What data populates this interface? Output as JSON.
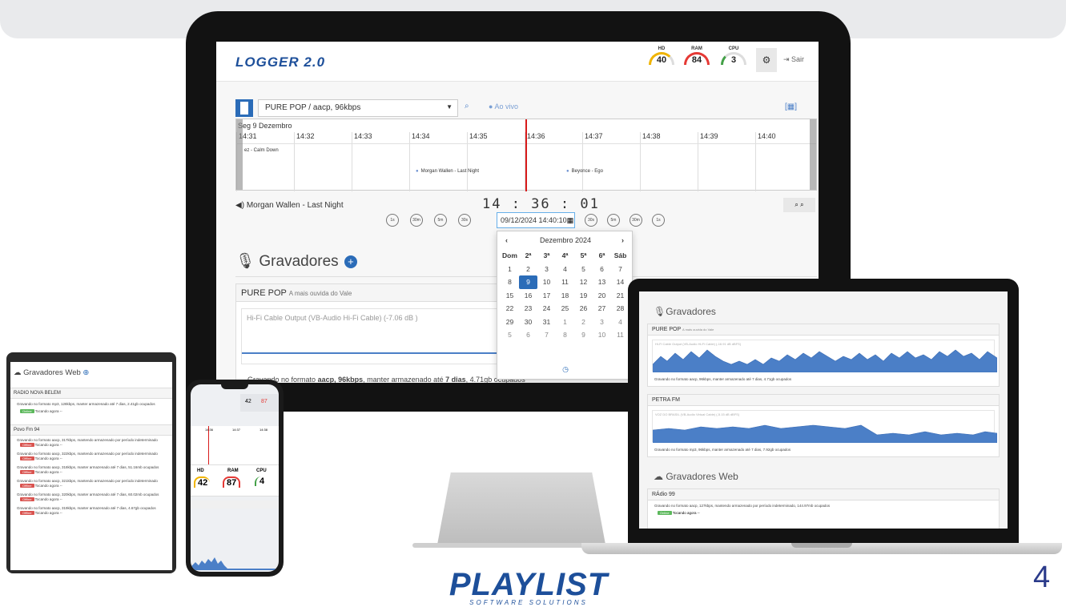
{
  "monitor": {
    "logo": "LOGGER 2.0",
    "gauges": [
      {
        "label": "HD",
        "value": "40",
        "color": "#f0b400"
      },
      {
        "label": "RAM",
        "value": "84",
        "color": "#e53935"
      },
      {
        "label": "CPU",
        "value": "3",
        "color": "#43a047"
      }
    ],
    "settings_icon": "gear-icon",
    "logout_label": "⇥ Sair",
    "station_select": "PURE POP / aacp, 96kbps",
    "live_label": "● Ao vivo",
    "timeline": {
      "date": "Seg 9 Dezembro",
      "ticks": [
        "14:31",
        "14:32",
        "14:33",
        "14:34",
        "14:35",
        "14:36",
        "14:37",
        "14:38",
        "14:39",
        "14:40"
      ],
      "songs": [
        "ez - Calm Down",
        "Morgan Wallen - Last Night",
        "Beyonce - Ego"
      ]
    },
    "now_playing": "Morgan Wallen - Last Night",
    "clock": "14 : 36 : 01",
    "skip_back": [
      "1s",
      "30m",
      "5m",
      "30s"
    ],
    "skip_fwd": [
      "30s",
      "5m",
      "30m",
      "1s"
    ],
    "date_value": "09/12/2024 14:40:10",
    "calendar": {
      "month": "Dezembro 2024",
      "weekdays": [
        "Dom",
        "2ª",
        "3ª",
        "4ª",
        "5ª",
        "6ª",
        "Sáb"
      ],
      "weeks": [
        [
          "1",
          "2",
          "3",
          "4",
          "5",
          "6",
          "7"
        ],
        [
          "8",
          "9",
          "10",
          "11",
          "12",
          "13",
          "14"
        ],
        [
          "15",
          "16",
          "17",
          "18",
          "19",
          "20",
          "21"
        ],
        [
          "22",
          "23",
          "24",
          "25",
          "26",
          "27",
          "28"
        ],
        [
          "29",
          "30",
          "31",
          "1",
          "2",
          "3",
          "4"
        ],
        [
          "5",
          "6",
          "7",
          "8",
          "9",
          "10",
          "11"
        ]
      ],
      "selected": "9",
      "footer_icon": "clock-icon"
    },
    "recorders_title": "Gravadores",
    "recorder": {
      "name": "PURE POP",
      "tagline": "A mais ouvida do Vale",
      "input": "Hi-Fi Cable Output (VB-Audio Hi-Fi Cable) (-7.06 dB )",
      "note_prefix": "Gravando no formato ",
      "format": "aacp, 96kbps",
      "note_mid": ", manter armazenado até ",
      "days": "7 dias",
      "note_suffix": ", 4.71gb ocupados"
    }
  },
  "laptop": {
    "title": "Gravadores",
    "panels": [
      {
        "name": "PURE POP",
        "tagline": "A mais ouvida do Vale",
        "input": "Hi-Fi Cable Output (VB-Audio Hi-Fi Cable) (-16.91 dB dBFS)",
        "note": "Gravando no formato aacp, 96kbps, manter armazenado até 7 dias, 4.71gb ocupados"
      },
      {
        "name": "PETRA FM",
        "tagline": "",
        "input": "VOZ DO BRASIL (VB-Audio Virtual Cable) (-5.15 dB dBFS)",
        "note": "Gravando no formato mp3, 96kbps, manter armazenado até 7 dias, 7.92gb ocupados"
      }
    ],
    "web_title": "Gravadores Web",
    "web_station": "RÁdio 99",
    "web_note": "Gravando no formato aacp, 127kbps, mantendo armazenado por período indeterminado, 144.97mb ocupados",
    "web_badge": "Online",
    "web_playing": "Tocando agora --"
  },
  "tablet": {
    "title": "Gravadores Web",
    "station1": "RADIO NOVA BELEM",
    "station1_note": "Gravando no formato mp3, 128kbps, manter armazenado até 7 dias, 2.41gb ocupados",
    "station2": "Povo Fm 94",
    "rows": [
      {
        "note": "Gravando no formato aacp, 317kbps, mantendo armazenado por período indeterminado",
        "badge": "Offline"
      },
      {
        "note": "Gravando no formato aacp, 322kbps, mantendo armazenado por período indeterminado",
        "badge": "Offline"
      },
      {
        "note": "Gravando no formato aacp, 318kbps, manter armazenado até 7 dias, 51.16mb ocupados",
        "badge": "Offline"
      },
      {
        "note": "Gravando no formato aacp, 321kbps, mantendo armazenado por período indeterminado",
        "badge": "Offline"
      },
      {
        "note": "Gravando no formato aacp, 320kbps, manter armazenado até 7 dias, 60.02mb ocupados",
        "badge": "Offline"
      },
      {
        "note": "Gravando no formato aacp, 319kbps, manter armazenado até 7 dias, 4.67gb ocupados",
        "badge": "Offline"
      }
    ],
    "online_badge": "Online",
    "playing": "Tocando agora --"
  },
  "phone": {
    "gauges": [
      {
        "label": "HD",
        "value": "42",
        "color": "#f0b400"
      },
      {
        "label": "RAM",
        "value": "87",
        "color": "#e53935"
      },
      {
        "label": "CPU",
        "value": "4",
        "color": "#43a047"
      }
    ],
    "ticks": [
      "14:36",
      "14:37",
      "14:38"
    ]
  },
  "brand": {
    "name": "PLAYLIST",
    "tagline": "SOFTWARE SOLUTIONS"
  },
  "page_number": "4"
}
